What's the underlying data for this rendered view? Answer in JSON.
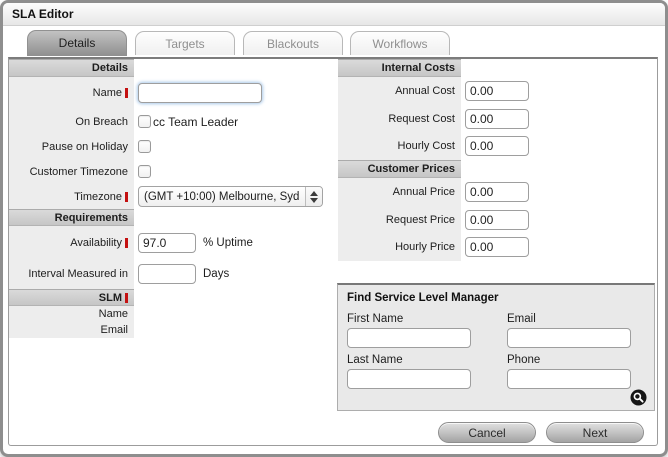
{
  "window_title": "SLA Editor",
  "tabs": {
    "details": "Details",
    "targets": "Targets",
    "blackouts": "Blackouts",
    "workflows": "Workflows"
  },
  "details_section": {
    "header": "Details",
    "name_label": "Name",
    "name_value": "",
    "on_breach_label": "On Breach",
    "cc_team_leader_label": "cc Team Leader",
    "pause_on_holiday_label": "Pause on Holiday",
    "customer_timezone_label": "Customer Timezone",
    "timezone_label": "Timezone",
    "timezone_value": "(GMT +10:00) Melbourne, Syd"
  },
  "requirements_section": {
    "header": "Requirements",
    "availability_label": "Availability",
    "availability_value": "97.0",
    "availability_suffix": "% Uptime",
    "interval_label": "Interval Measured in",
    "interval_value": "",
    "interval_suffix": "Days"
  },
  "slm_section": {
    "header": "SLM",
    "name_label": "Name",
    "name_value": "",
    "email_label": "Email",
    "email_value": ""
  },
  "internal_costs_section": {
    "header": "Internal Costs",
    "annual_cost_label": "Annual Cost",
    "annual_cost_value": "0.00",
    "request_cost_label": "Request Cost",
    "request_cost_value": "0.00",
    "hourly_cost_label": "Hourly Cost",
    "hourly_cost_value": "0.00"
  },
  "customer_prices_section": {
    "header": "Customer Prices",
    "annual_price_label": "Annual Price",
    "annual_price_value": "0.00",
    "request_price_label": "Request Price",
    "request_price_value": "0.00",
    "hourly_price_label": "Hourly Price",
    "hourly_price_value": "0.00"
  },
  "find_slm_panel": {
    "title": "Find Service Level Manager",
    "first_name_label": "First Name",
    "first_name_value": "",
    "email_label": "Email",
    "email_value": "",
    "last_name_label": "Last Name",
    "last_name_value": "",
    "phone_label": "Phone",
    "phone_value": ""
  },
  "footer": {
    "cancel_label": "Cancel",
    "next_label": "Next"
  },
  "icons": {
    "search": "magnifier-in-black-circle",
    "timezone_stepper": "up-down-arrows"
  },
  "colors": {
    "required_marker": "#c41111",
    "focus_ring": "#8fb6e4",
    "active_tab": "#8f8f8f",
    "header_band": "#cccccc"
  }
}
